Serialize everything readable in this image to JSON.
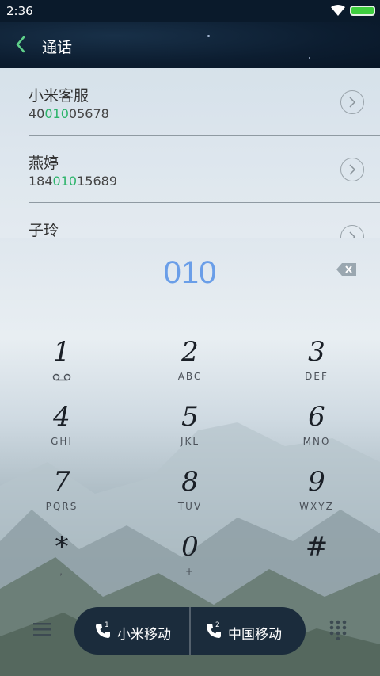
{
  "status": {
    "time": "2:36"
  },
  "header": {
    "title": "通话"
  },
  "contacts": [
    {
      "name": "小米客服",
      "number_pre": "40",
      "number_hl": "010",
      "number_post": "05678"
    },
    {
      "name": "燕婷",
      "number_pre": "184",
      "number_hl": "010",
      "number_post": "15689"
    },
    {
      "name": "子玲",
      "number_pre": "",
      "number_hl": "",
      "number_post": ""
    }
  ],
  "dial": {
    "entered": "010",
    "keys": [
      {
        "digit": "1",
        "letters": ""
      },
      {
        "digit": "2",
        "letters": "ABC"
      },
      {
        "digit": "3",
        "letters": "DEF"
      },
      {
        "digit": "4",
        "letters": "GHI"
      },
      {
        "digit": "5",
        "letters": "JKL"
      },
      {
        "digit": "6",
        "letters": "MNO"
      },
      {
        "digit": "7",
        "letters": "PQRS"
      },
      {
        "digit": "8",
        "letters": "TUV"
      },
      {
        "digit": "9",
        "letters": "WXYZ"
      },
      {
        "digit": "*",
        "letters": ","
      },
      {
        "digit": "0",
        "letters": "+"
      },
      {
        "digit": "#",
        "letters": ""
      }
    ]
  },
  "call": {
    "sim1": {
      "slot": "1",
      "label": "小米移动"
    },
    "sim2": {
      "slot": "2",
      "label": "中国移动"
    }
  },
  "colors": {
    "accent_digits": "#6a9ee8",
    "match_highlight": "#2cb46a",
    "pill_bg": "#1b2c3c",
    "battery": "#3fce3f"
  }
}
